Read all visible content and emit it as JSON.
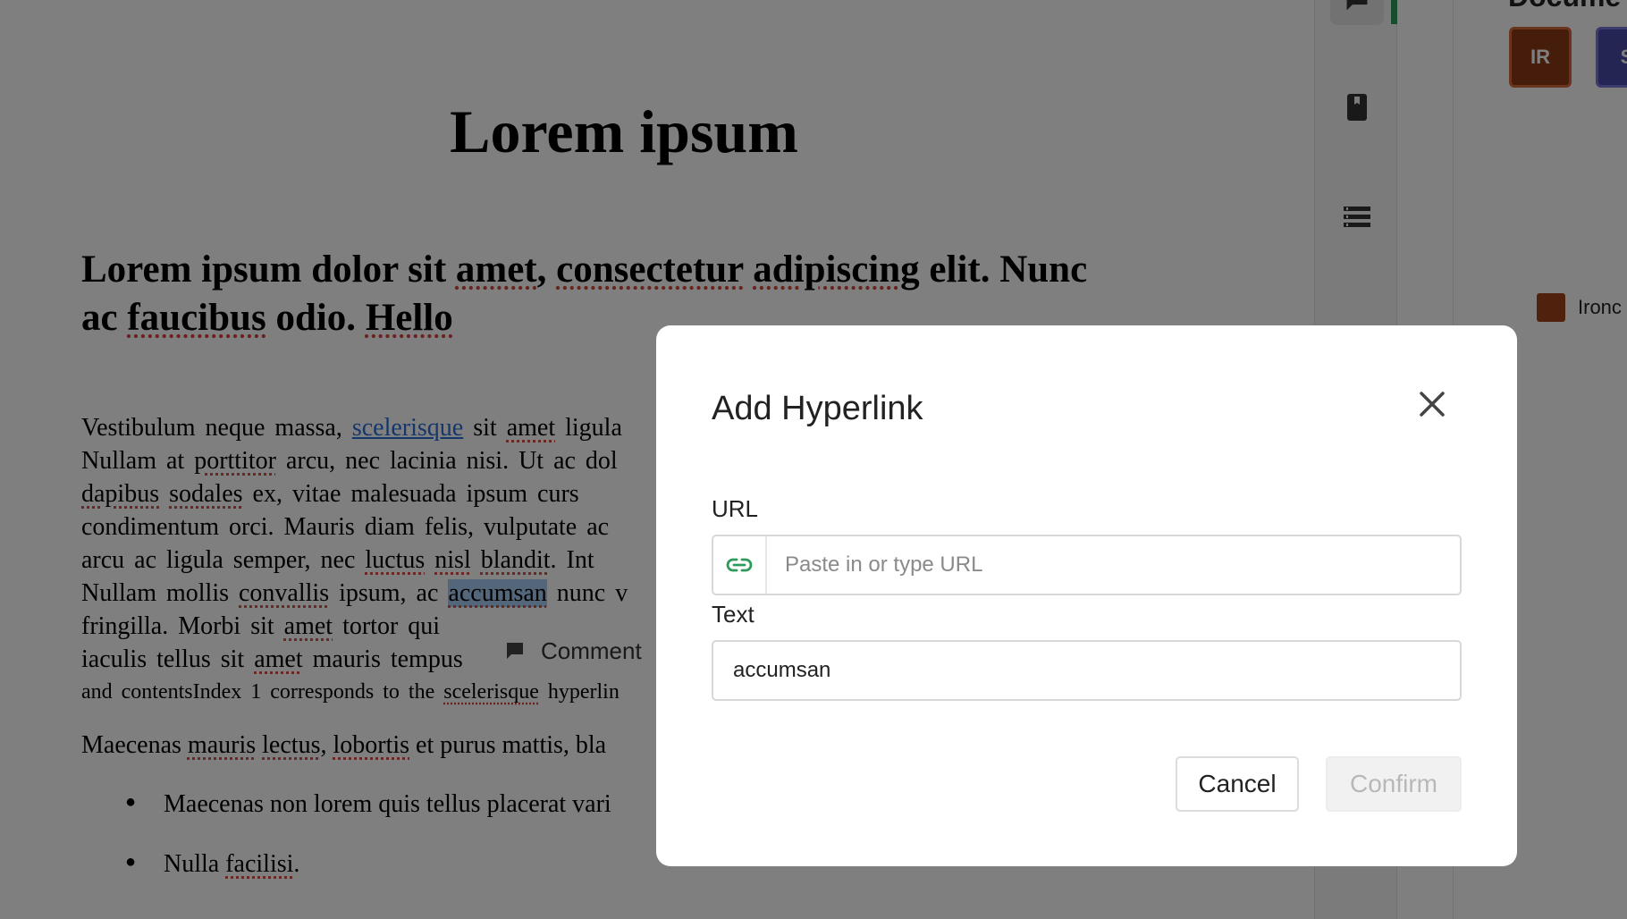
{
  "document": {
    "title": "Lorem ipsum",
    "heading_line1": "Lorem ipsum dolor sit amet, consectetur adipiscing elit. Nunc",
    "heading_line2": "ac faucibus odio. Hello",
    "para_lines": [
      "Vestibulum neque massa, scelerisque sit amet ligula",
      "Nullam at porttitor arcu, nec lacinia nisi. Ut ac dol",
      "dapibus sodales ex, vitae malesuada ipsum curs",
      "condimentum orci. Mauris diam felis, vulputate ac",
      "arcu ac ligula semper, nec luctus nisl blandit. Int",
      "Nullam mollis convallis ipsum, ac accumsan nunc v",
      "fringilla. Morbi sit amet tortor qui",
      "iaculis tellus sit amet mauris tempus",
      "and contentsIndex 1 corresponds to the scelerisque hyperlin"
    ],
    "link_word": "scelerisque",
    "selected_word": "accumsan",
    "para2": "Maecenas mauris lectus, lobortis et purus mattis, bla",
    "bullets": [
      "Maecenas non lorem quis tellus placerat vari",
      "Nulla facilisi."
    ]
  },
  "comment_popup": {
    "label": "Comment",
    "icon": "comment-icon"
  },
  "rail": {
    "icons": [
      "comment-icon",
      "bookmark-icon",
      "list-icon"
    ],
    "accent": "#2e9b5b"
  },
  "panel": {
    "title": "Docume",
    "avatars": [
      {
        "initials": "IR",
        "color": "#8b3a14"
      },
      {
        "initials": "S",
        "color": "#4a4aa8"
      }
    ],
    "legend_label": "Ironc",
    "legend_color": "#a0441b"
  },
  "modal": {
    "title": "Add Hyperlink",
    "url_label": "URL",
    "url_placeholder": "Paste in or type URL",
    "url_value": "",
    "text_label": "Text",
    "text_value": "accumsan",
    "cancel_label": "Cancel",
    "confirm_label": "Confirm",
    "link_icon_color": "#2e9b5b"
  }
}
